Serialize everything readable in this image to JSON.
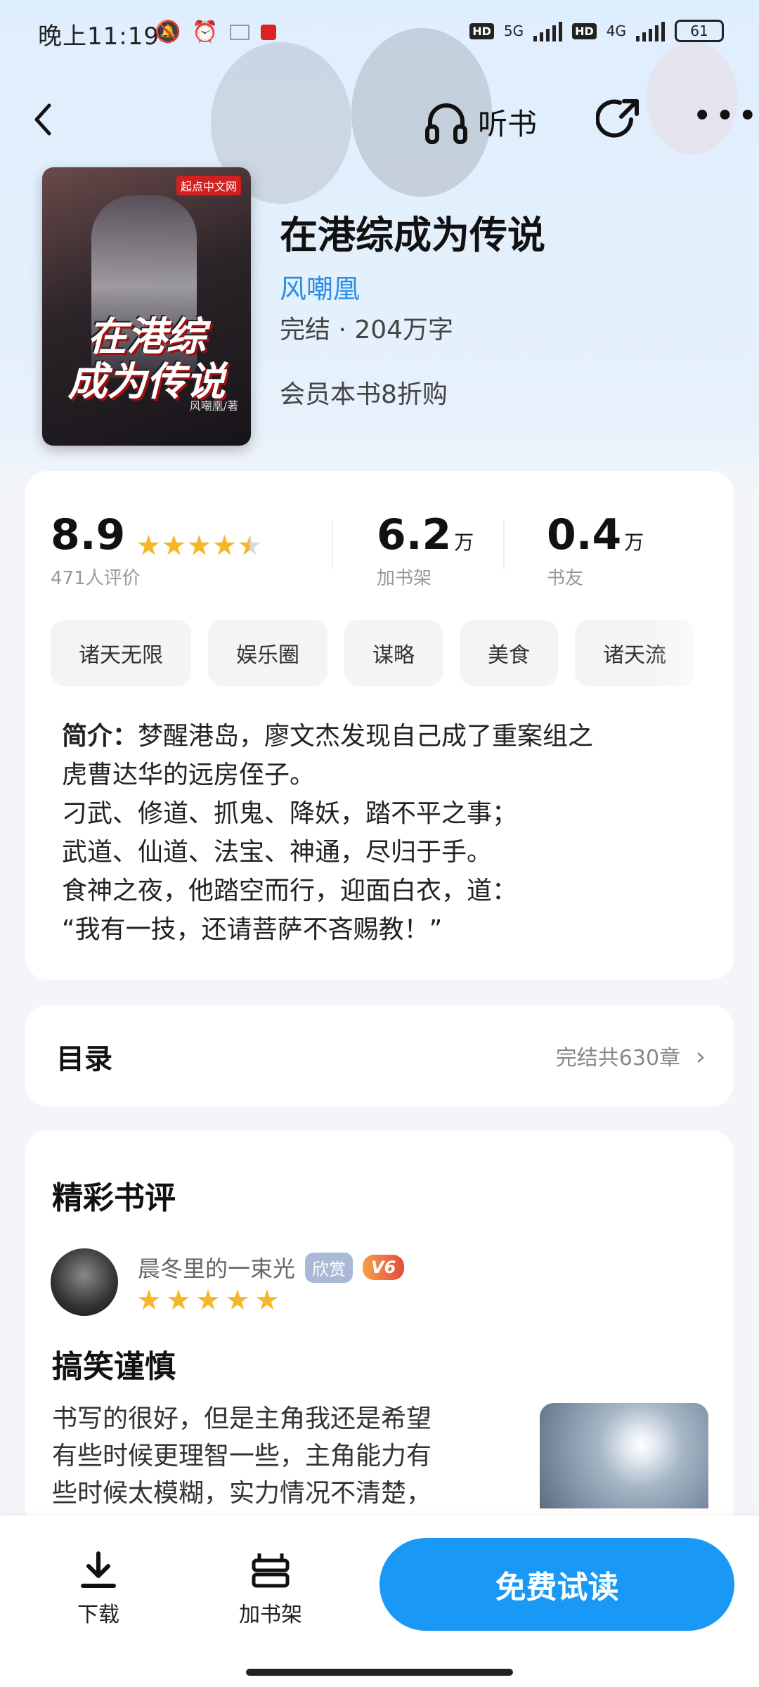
{
  "status_bar": {
    "time": "晚上11:19",
    "network_1": "5G",
    "network_2": "4G",
    "battery": "61"
  },
  "nav": {
    "listen_label": "听书"
  },
  "book": {
    "title": "在港综成为传说",
    "author": "风嘲凰",
    "status": "完结 · 204万字",
    "member_offer": "会员本书8折购",
    "cover_badge": "起点中文网",
    "cover_title_line1": "在港综",
    "cover_title_line2": "成为传说",
    "cover_author": "风嘲凰/著"
  },
  "stats": {
    "rating": "8.9",
    "rating_stars": 4.5,
    "rating_count_label": "471人评价",
    "shelf_value": "6.2",
    "shelf_unit": "万",
    "shelf_label": "加书架",
    "friends_value": "0.4",
    "friends_unit": "万",
    "friends_label": "书友"
  },
  "tags": [
    "诸天无限",
    "娱乐圈",
    "谋略",
    "美食",
    "诸天流"
  ],
  "intro": {
    "label": "简介：",
    "lines": [
      "梦醒港岛，廖文杰发现自己成了重案组之",
      "虎曹达华的远房侄子。",
      "刁武、修道、抓鬼、降妖，踏不平之事；",
      "武道、仙道、法宝、神通，尽归于手。",
      "食神之夜，他踏空而行，迎面白衣，道：",
      "“我有一技，还请菩萨不吝赐教！”"
    ]
  },
  "toc": {
    "title": "目录",
    "info": "完结共630章",
    "chevron": "›"
  },
  "reviews": {
    "section_title": "精彩书评",
    "reviewer_name": "晨冬里的一束光",
    "badge_enjoy": "欣赏",
    "badge_vip": "V6",
    "stars": 5,
    "review_title": "搞笑谨慎",
    "review_lines": [
      "书写的很好，但是主角我还是希望",
      "有些时候更理智一些，主角能力有",
      "些时候太模糊，实力情况不清楚，"
    ]
  },
  "bottom_bar": {
    "download_label": "下载",
    "shelf_label": "加书架",
    "read_button": "免费试读"
  },
  "colors": {
    "accent_blue": "#1a98f5",
    "author_blue": "#2a8ee8",
    "star_gold": "#f5b729"
  }
}
